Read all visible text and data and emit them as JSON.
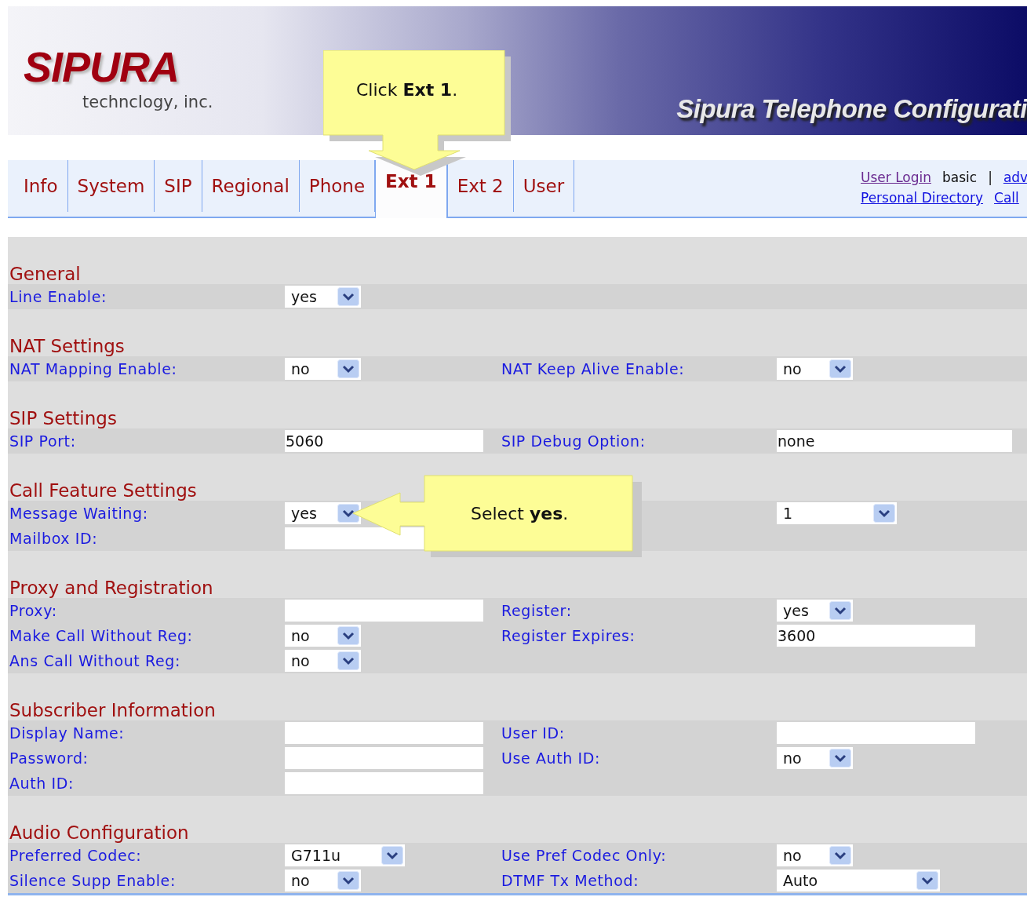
{
  "header": {
    "logo": "SIPURA",
    "logo_subtitle": "techncIogy, inc.",
    "title": "Sipura Telephone Configurati"
  },
  "tabs": [
    {
      "label": "Info",
      "selected": false
    },
    {
      "label": "System",
      "selected": false
    },
    {
      "label": "SIP",
      "selected": false
    },
    {
      "label": "Regional",
      "selected": false
    },
    {
      "label": "Phone",
      "selected": false
    },
    {
      "label": "Ext 1",
      "selected": true
    },
    {
      "label": "Ext 2",
      "selected": false
    },
    {
      "label": "User",
      "selected": false
    }
  ],
  "links": {
    "row_1": [
      {
        "kind": "link",
        "text": "User Login",
        "visited": true
      },
      {
        "kind": "text",
        "text": "basic"
      },
      {
        "kind": "text",
        "text": "|"
      },
      {
        "kind": "link",
        "text": "adv",
        "visited": false
      }
    ],
    "row_2": [
      {
        "kind": "link",
        "text": "Personal Directory",
        "visited": false
      },
      {
        "kind": "link",
        "text": "Call",
        "visited": false
      }
    ]
  },
  "sections": [
    {
      "title": "General",
      "rows": [
        [
          {
            "label": "Line Enable:",
            "control": {
              "kind": "select",
              "value": "yes"
            }
          }
        ]
      ]
    },
    {
      "title": "NAT Settings",
      "rows": [
        [
          {
            "label": "NAT Mapping Enable:",
            "control": {
              "kind": "select",
              "value": "no"
            }
          },
          {
            "label": "NAT Keep Alive Enable:",
            "control": {
              "kind": "select",
              "value": "no"
            }
          }
        ]
      ]
    },
    {
      "title": "SIP Settings",
      "rows": [
        [
          {
            "label": "SIP Port:",
            "control": {
              "kind": "text",
              "value": "5060"
            }
          },
          {
            "label": "SIP Debug Option:",
            "control": {
              "kind": "text-wide",
              "value": "none"
            }
          }
        ]
      ]
    },
    {
      "title": "Call Feature Settings",
      "rows": [
        [
          {
            "label": "Message Waiting:",
            "control": {
              "kind": "select",
              "value": "yes"
            }
          },
          {
            "control": {
              "kind": "select-medium",
              "value": "1"
            }
          }
        ],
        [
          {
            "label": "Mailbox ID:",
            "control": {
              "kind": "text"
            }
          }
        ]
      ]
    },
    {
      "title": "Proxy and Registration",
      "rows": [
        [
          {
            "label": "Proxy:",
            "control": {
              "kind": "text"
            }
          },
          {
            "label": "Register:",
            "control": {
              "kind": "select",
              "value": "yes"
            }
          }
        ],
        [
          {
            "label": "Make Call Without Reg:",
            "control": {
              "kind": "select",
              "value": "no"
            }
          },
          {
            "label": "Register Expires:",
            "control": {
              "kind": "text",
              "value": "3600"
            }
          }
        ],
        [
          {
            "label": "Ans Call Without Reg:",
            "control": {
              "kind": "select",
              "value": "no"
            }
          }
        ]
      ]
    },
    {
      "title": "Subscriber Information",
      "rows": [
        [
          {
            "label": "Display Name:",
            "control": {
              "kind": "text"
            }
          },
          {
            "label": "User ID:",
            "control": {
              "kind": "text"
            }
          }
        ],
        [
          {
            "label": "Password:",
            "control": {
              "kind": "text"
            }
          },
          {
            "label": "Use Auth ID:",
            "control": {
              "kind": "select",
              "value": "no"
            }
          }
        ],
        [
          {
            "label": "Auth ID:",
            "control": {
              "kind": "text"
            }
          }
        ]
      ]
    },
    {
      "title": "Audio Configuration",
      "rows": [
        [
          {
            "label": "Preferred Codec:",
            "control": {
              "kind": "select-medium",
              "value": "G711u"
            }
          },
          {
            "label": "Use Pref Codec Only:",
            "control": {
              "kind": "select",
              "value": "no"
            }
          }
        ],
        [
          {
            "label": "Silence Supp Enable:",
            "control": {
              "kind": "select",
              "value": "no"
            }
          },
          {
            "label": "DTMF Tx Method:",
            "control": {
              "kind": "select-wide",
              "value": "Auto"
            }
          }
        ]
      ]
    }
  ],
  "callouts": [
    {
      "kind": "down",
      "text": "Click **Ext 1**."
    },
    {
      "kind": "left",
      "text": "Select **yes**."
    }
  ]
}
